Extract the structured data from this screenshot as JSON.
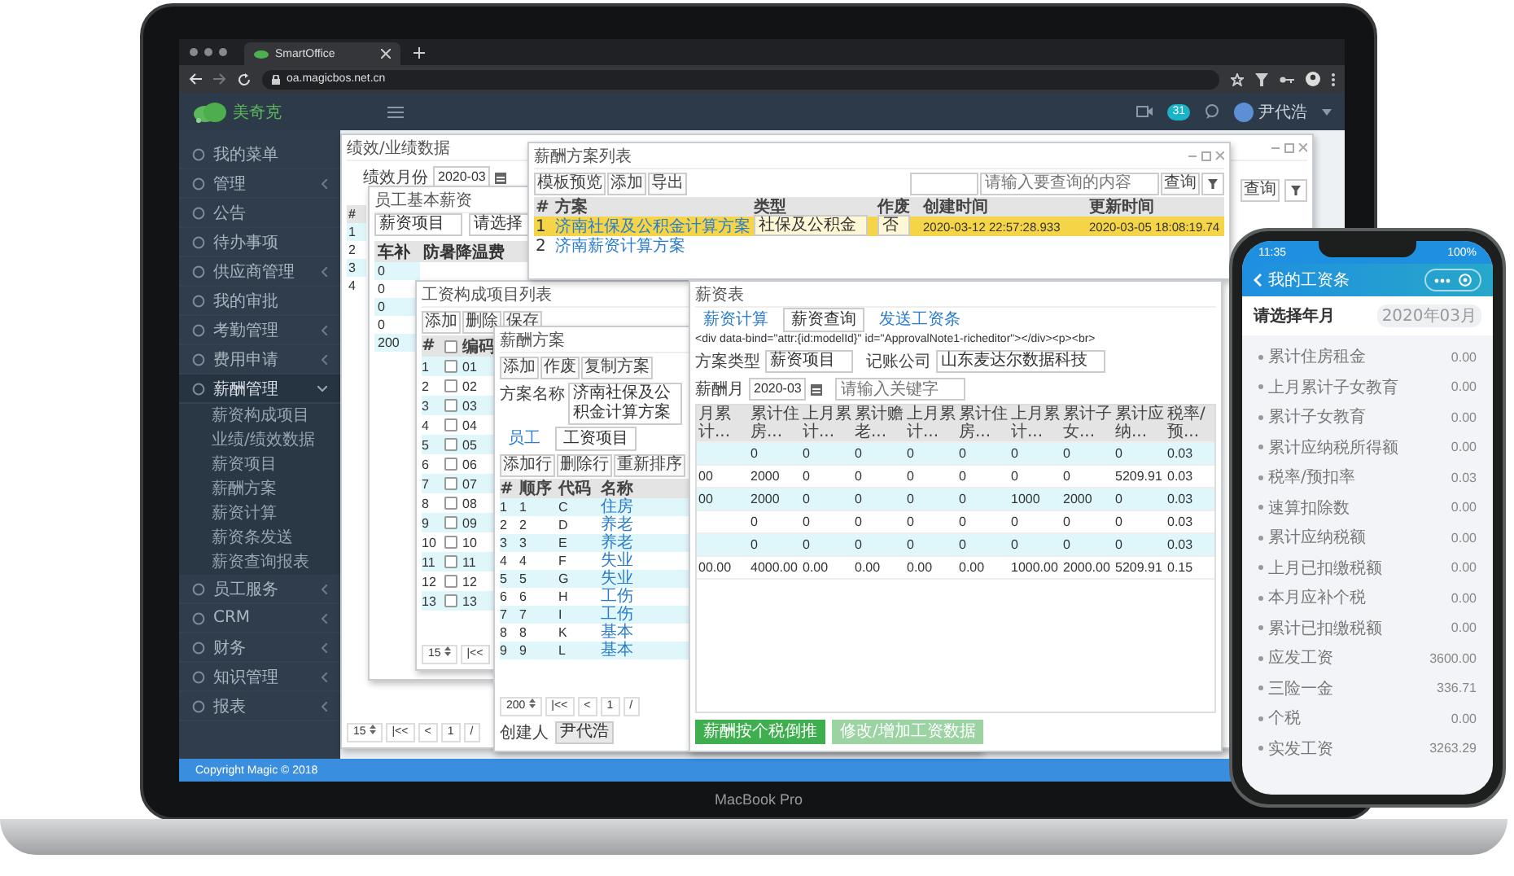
{
  "browser": {
    "tab": "SmartOffice",
    "url": "oa.magicbos.net.cn"
  },
  "app_header": {
    "logo_text": "美奇克",
    "notification_count": "31",
    "user": "尹代浩"
  },
  "sidebar": {
    "items": [
      {
        "label": "我的菜单",
        "expandable": false,
        "expanded": false
      },
      {
        "label": "管理",
        "expandable": true,
        "expanded": false
      },
      {
        "label": "公告",
        "expandable": false,
        "expanded": false
      },
      {
        "label": "待办事项",
        "expandable": false,
        "expanded": false
      },
      {
        "label": "供应商管理",
        "expandable": true,
        "expanded": false
      },
      {
        "label": "我的审批",
        "expandable": false,
        "expanded": false
      },
      {
        "label": "考勤管理",
        "expandable": true,
        "expanded": false
      },
      {
        "label": "费用申请",
        "expandable": true,
        "expanded": false
      },
      {
        "label": "薪酬管理",
        "expandable": true,
        "expanded": true,
        "children": [
          {
            "label": "薪资构成项目"
          },
          {
            "label": "业绩/绩效数据"
          },
          {
            "label": "薪资项目"
          },
          {
            "label": "薪酬方案"
          },
          {
            "label": "薪资计算"
          },
          {
            "label": "薪资条发送"
          },
          {
            "label": "薪资查询报表"
          }
        ]
      },
      {
        "label": "员工服务",
        "expandable": true,
        "expanded": false
      },
      {
        "label": "CRM",
        "expandable": true,
        "expanded": false
      },
      {
        "label": "财务",
        "expandable": true,
        "expanded": false
      },
      {
        "label": "知识管理",
        "expandable": true,
        "expanded": false
      },
      {
        "label": "报表",
        "expandable": true,
        "expanded": false
      }
    ]
  },
  "windows": [
    {
      "kind": "performance",
      "title": "绩效/业绩数据",
      "month_label": "绩效月份",
      "month_value": "2020-03",
      "search_button": "查询",
      "row_header": "#",
      "rows": [
        "1",
        "2",
        "3",
        "4"
      ],
      "page_size": "15",
      "pager": [
        "|<<",
        "<",
        "1",
        "/"
      ]
    },
    {
      "kind": "basic_salary",
      "title": "员工基本薪资",
      "filter": "薪资项目",
      "select": "请选择",
      "columns": [
        "车补",
        "防暑降温费"
      ],
      "column_values": [
        "0",
        "0",
        "0",
        "0",
        "200"
      ]
    },
    {
      "kind": "salary_items",
      "title": "工资构成项目列表",
      "buttons": [
        "添加",
        "删除",
        "保存"
      ],
      "columns": [
        "#",
        "编码"
      ],
      "all_checked": false,
      "rows": [
        {
          "n": "1",
          "code": "01",
          "checked": false
        },
        {
          "n": "2",
          "code": "02",
          "checked": false
        },
        {
          "n": "3",
          "code": "03",
          "checked": false
        },
        {
          "n": "4",
          "code": "04",
          "checked": false
        },
        {
          "n": "5",
          "code": "05",
          "checked": false
        },
        {
          "n": "6",
          "code": "06",
          "checked": false
        },
        {
          "n": "7",
          "code": "07",
          "checked": false
        },
        {
          "n": "8",
          "code": "08",
          "checked": false
        },
        {
          "n": "9",
          "code": "09",
          "checked": false
        },
        {
          "n": "10",
          "code": "10",
          "checked": false
        },
        {
          "n": "11",
          "code": "11",
          "checked": false
        },
        {
          "n": "12",
          "code": "12",
          "checked": false
        },
        {
          "n": "13",
          "code": "13",
          "checked": false
        }
      ],
      "page_size": "15",
      "pager": [
        "|<<"
      ]
    },
    {
      "kind": "scheme_list",
      "title": "薪酬方案列表",
      "buttons": [
        "模板预览",
        "添加",
        "导出"
      ],
      "search_placeholder": "请输入要查询的内容",
      "search_button": "查询",
      "columns": [
        "#",
        "方案",
        "类型",
        "作废",
        "创建时间",
        "更新时间"
      ],
      "rows": [
        {
          "n": "1",
          "name": "济南社保及公积金计算方案",
          "type": "社保及公积金",
          "void": "否",
          "created": "2020-03-12 22:57:28.933",
          "updated": "2020-03-05 18:08:19.74",
          "selected": true
        },
        {
          "n": "2",
          "name": "济南薪资计算方案",
          "selected": false
        }
      ]
    },
    {
      "kind": "scheme",
      "title": "薪酬方案",
      "buttons": [
        "添加",
        "作废",
        "复制方案"
      ],
      "name_label": "方案名称",
      "name_value": "济南社保及公积金计算方案",
      "tabs": [
        {
          "label": "员工",
          "selected": false
        },
        {
          "label": "工资项目",
          "selected": true
        }
      ],
      "row_buttons": [
        "添加行",
        "删除行",
        "重新排序"
      ],
      "columns": [
        "#",
        "顺序",
        "代码",
        "名称"
      ],
      "rows": [
        [
          "1",
          "1",
          "C",
          "住房"
        ],
        [
          "2",
          "2",
          "D",
          "养老"
        ],
        [
          "3",
          "3",
          "E",
          "养老"
        ],
        [
          "4",
          "4",
          "F",
          "失业"
        ],
        [
          "5",
          "5",
          "G",
          "失业"
        ],
        [
          "6",
          "6",
          "H",
          "工伤"
        ],
        [
          "7",
          "7",
          "I",
          "工伤"
        ],
        [
          "8",
          "8",
          "K",
          "基本"
        ],
        [
          "9",
          "9",
          "L",
          "基本"
        ]
      ],
      "page_size": "200",
      "pager": [
        "|<<",
        "<",
        "1",
        "/"
      ],
      "creator_label": "创建人",
      "creator": "尹代浩"
    },
    {
      "kind": "payroll",
      "title": "薪资表",
      "tabs": [
        {
          "label": "薪资计算",
          "selected": false
        },
        {
          "label": "薪资查询",
          "selected": true
        },
        {
          "label": "发送工资条",
          "selected": false
        }
      ],
      "markup_text": "<div data-bind=\"attr:{id:modelId}\" id=\"ApprovalNote1-richeditor\"></div><p><br>",
      "filters": [
        {
          "label": "方案类型",
          "value": "薪资项目",
          "kind": "select"
        },
        {
          "label": "记账公司",
          "value": "山东麦达尔数据科技",
          "kind": "select"
        },
        {
          "label": "薪酬月",
          "value": "2020-03",
          "kind": "date"
        }
      ],
      "keyword_placeholder": "请输入关键字",
      "columns": [
        "月累计...",
        "累计住房...",
        "上月累计...",
        "累计赡老...",
        "上月累计...",
        "累计住房...",
        "上月累计...",
        "累计子女...",
        "累计应纳...",
        "税率/预..."
      ],
      "rows": [
        [
          "",
          "0",
          "0",
          "0",
          "0",
          "0",
          "0",
          "0",
          "0",
          "0.03"
        ],
        [
          "00",
          "2000",
          "0",
          "0",
          "0",
          "0",
          "0",
          "0",
          "5209.91",
          "0.03"
        ],
        [
          "00",
          "2000",
          "0",
          "0",
          "0",
          "0",
          "1000",
          "2000",
          "0",
          "0.03"
        ],
        [
          "",
          "0",
          "0",
          "0",
          "0",
          "0",
          "0",
          "0",
          "0",
          "0.03"
        ],
        [
          "",
          "0",
          "0",
          "0",
          "0",
          "0",
          "0",
          "0",
          "0",
          "0.03"
        ],
        [
          "00.00",
          "4000.00",
          "0.00",
          "0.00",
          "0.00",
          "0.00",
          "1000.00",
          "2000.00",
          "5209.91",
          "0.15"
        ]
      ],
      "buttons": [
        {
          "label": "薪酬按个税倒推",
          "disabled": false
        },
        {
          "label": "修改/增加工资数据",
          "disabled": true
        }
      ]
    }
  ],
  "footer": "Copyright Magic © 2018",
  "laptop": {
    "model": "MacBook Pro"
  },
  "phone": {
    "time": "11:35",
    "battery": "100%",
    "title": "我的工资条",
    "picker_label": "请选择年月",
    "picker_value": "2020年03月",
    "items": [
      {
        "label": "累计住房租金",
        "value": "0.00"
      },
      {
        "label": "上月累计子女教育",
        "value": "0.00"
      },
      {
        "label": "累计子女教育",
        "value": "0.00"
      },
      {
        "label": "累计应纳税所得额",
        "value": "0.00"
      },
      {
        "label": "税率/预扣率",
        "value": "0.03"
      },
      {
        "label": "速算扣除数",
        "value": "0.00"
      },
      {
        "label": "累计应纳税额",
        "value": "0.00"
      },
      {
        "label": "上月已扣缴税额",
        "value": "0.00"
      },
      {
        "label": "本月应补个税",
        "value": "0.00"
      },
      {
        "label": "累计已扣缴税额",
        "value": "0.00"
      },
      {
        "label": "应发工资",
        "value": "3600.00"
      },
      {
        "label": "三险一金",
        "value": "336.71"
      },
      {
        "label": "个税",
        "value": "0.00"
      },
      {
        "label": "实发工资",
        "value": "3263.29"
      }
    ]
  }
}
